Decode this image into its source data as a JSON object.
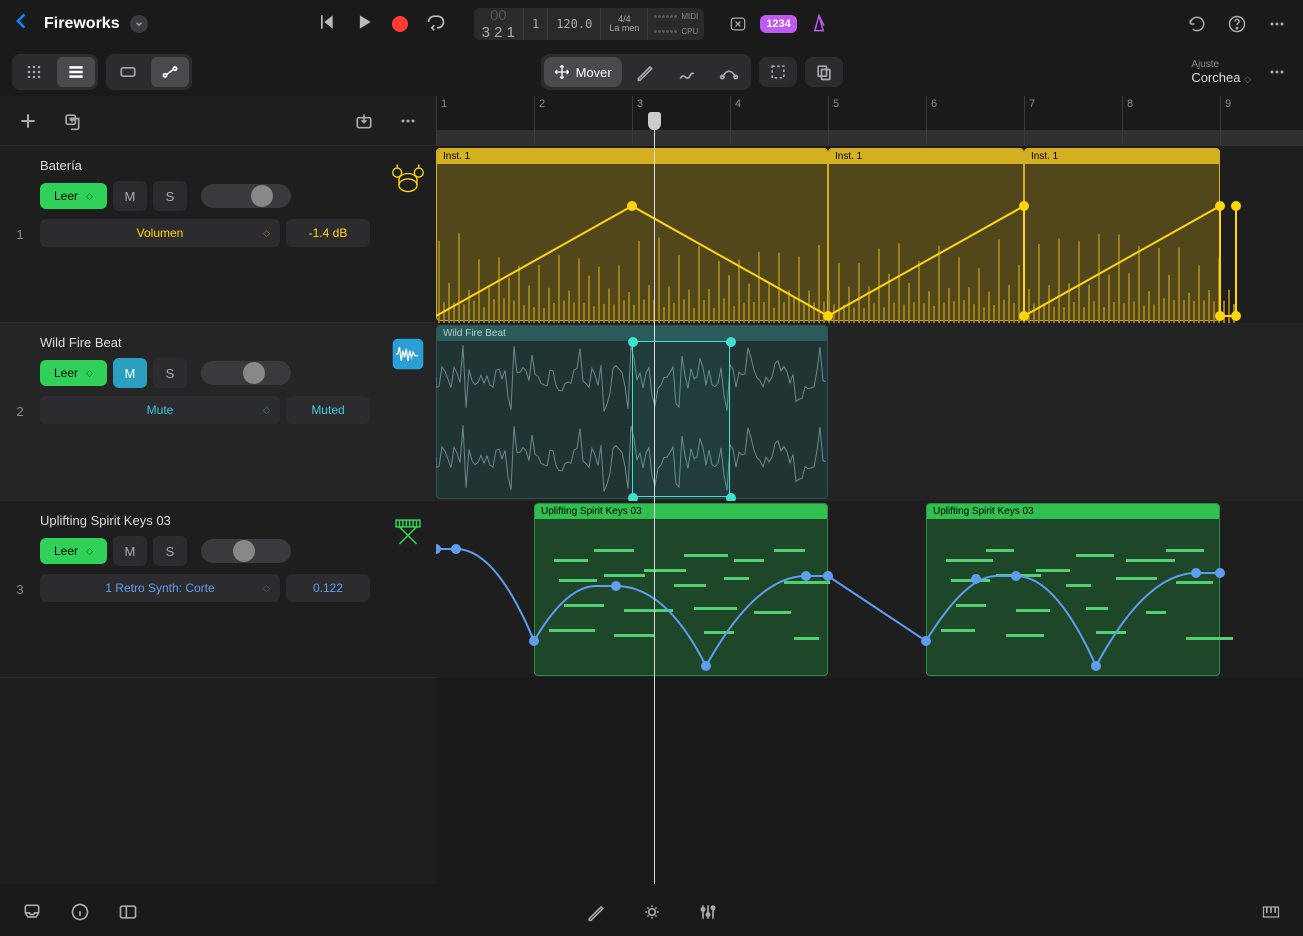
{
  "header": {
    "project_title": "Fireworks",
    "transport": {
      "position": "3 2 1",
      "beat": "1",
      "tempo": "120.0",
      "time_sig": "4/4",
      "key": "La men",
      "meter_labels": [
        "MIDI",
        "CPU"
      ]
    },
    "count_badge": "1234"
  },
  "toolbar": {
    "mover_label": "Mover",
    "ajuste_label": "Ajuste",
    "ajuste_value": "Corchea"
  },
  "ruler": {
    "ticks": [
      "1",
      "2",
      "3",
      "4",
      "5",
      "6",
      "7",
      "8",
      "9"
    ],
    "playhead_bar": 3.2
  },
  "tracks": [
    {
      "num": "1",
      "name": "Batería",
      "automation": "Leer",
      "mute": false,
      "solo": false,
      "param_name": "Volumen",
      "param_value": "-1.4 dB",
      "color": "yellow",
      "regions": [
        {
          "label": "Inst. 1",
          "start": 1,
          "end": 5
        },
        {
          "label": "Inst. 1",
          "start": 5,
          "end": 7
        },
        {
          "label": "Inst. 1",
          "start": 7,
          "end": 9
        }
      ]
    },
    {
      "num": "2",
      "name": "Wild Fire Beat",
      "automation": "Leer",
      "mute": true,
      "solo": false,
      "param_name": "Mute",
      "param_value": "Muted",
      "color": "teal",
      "regions": [
        {
          "label": "Wild Fire Beat",
          "start": 1,
          "end": 5
        }
      ],
      "selection": {
        "start": 3,
        "end": 4
      }
    },
    {
      "num": "3",
      "name": "Uplifting Spirit Keys 03",
      "automation": "Leer",
      "mute": false,
      "solo": false,
      "param_name": "1 Retro Synth: Corte",
      "param_value": "0.122",
      "color": "blue",
      "regions": [
        {
          "label": "Uplifting Spirit Keys 03",
          "start": 2,
          "end": 5
        },
        {
          "label": "Uplifting Spirit Keys 03",
          "start": 6,
          "end": 9
        }
      ]
    }
  ]
}
